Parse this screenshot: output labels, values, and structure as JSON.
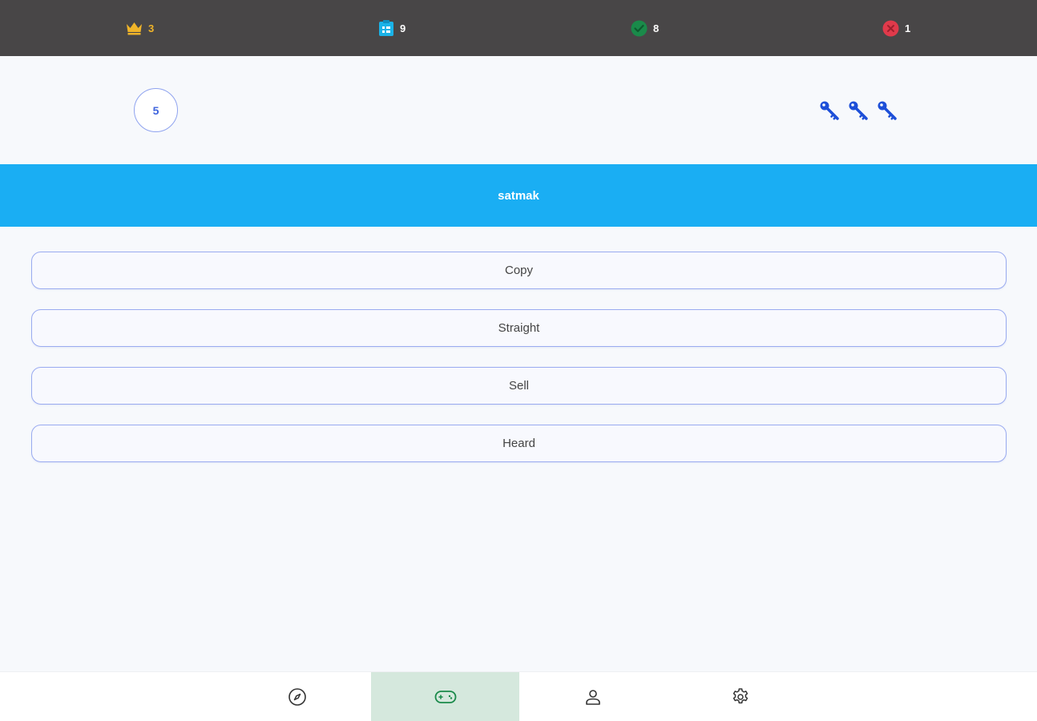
{
  "stats": {
    "crowns": "3",
    "clipboard": "9",
    "correct": "8",
    "wrong": "1"
  },
  "status": {
    "level": "5",
    "keys_count": 3
  },
  "word": "satmak",
  "options": [
    {
      "label": "Copy"
    },
    {
      "label": "Straight"
    },
    {
      "label": "Sell"
    },
    {
      "label": "Heard"
    }
  ],
  "nav": {
    "items": [
      "compass-icon",
      "gamepad-icon",
      "user-icon",
      "gear-icon"
    ],
    "active": "gamepad-icon"
  },
  "colors": {
    "top_bar": "#484647",
    "crown": "#f0b429",
    "clipboard": "#1ab3e8",
    "check": "#1a8a4a",
    "cross": "#e03a4b",
    "banner": "#1aaef3",
    "accent": "#3d63dd",
    "nav_active_bg": "#d5e8dd"
  }
}
